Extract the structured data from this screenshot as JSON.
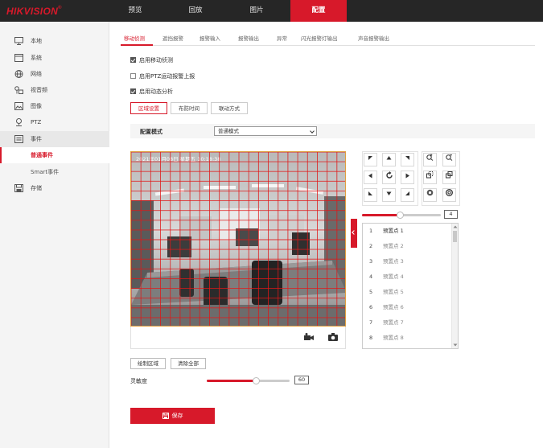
{
  "brand": {
    "logo": "HIKVISION",
    "reg": "®"
  },
  "nav": [
    "预览",
    "回放",
    "图片",
    "配置"
  ],
  "sidebar": {
    "items": [
      "本地",
      "系统",
      "网络",
      "视音频",
      "图像",
      "PTZ",
      "事件",
      "存储"
    ],
    "subitems": [
      "普通事件",
      "Smart事件"
    ]
  },
  "tabs": [
    "移动侦测",
    "遮挡报警",
    "报警输入",
    "报警输出",
    "异常",
    "闪光报警灯输出",
    "声音报警输出"
  ],
  "checks": [
    {
      "label": "启用移动侦测",
      "checked": true
    },
    {
      "label": "启用PTZ运动报警上报",
      "checked": false
    },
    {
      "label": "启用动态分析",
      "checked": true
    }
  ],
  "steps": [
    "区域设置",
    "布防时间",
    "联动方式"
  ],
  "config": {
    "label": "配置模式",
    "value": "普通模式"
  },
  "osd": "2021年01月08日 星期五 10:18:38",
  "ptz": {
    "speed": "4",
    "speed_fraction": 0.48
  },
  "presets": [
    {
      "n": "1",
      "label": "预置点 1"
    },
    {
      "n": "2",
      "label": "预置点 2"
    },
    {
      "n": "3",
      "label": "预置点 3"
    },
    {
      "n": "4",
      "label": "预置点 4"
    },
    {
      "n": "5",
      "label": "预置点 5"
    },
    {
      "n": "6",
      "label": "预置点 6"
    },
    {
      "n": "7",
      "label": "预置点 7"
    },
    {
      "n": "8",
      "label": "预置点 8"
    }
  ],
  "actions": {
    "draw": "绘制区域",
    "clear": "清除全部"
  },
  "sensitivity": {
    "label": "灵敏度",
    "value": "60",
    "fraction": 0.6
  },
  "save": "保存",
  "colors": {
    "accent": "#d7192a",
    "topbar": "#262626"
  }
}
